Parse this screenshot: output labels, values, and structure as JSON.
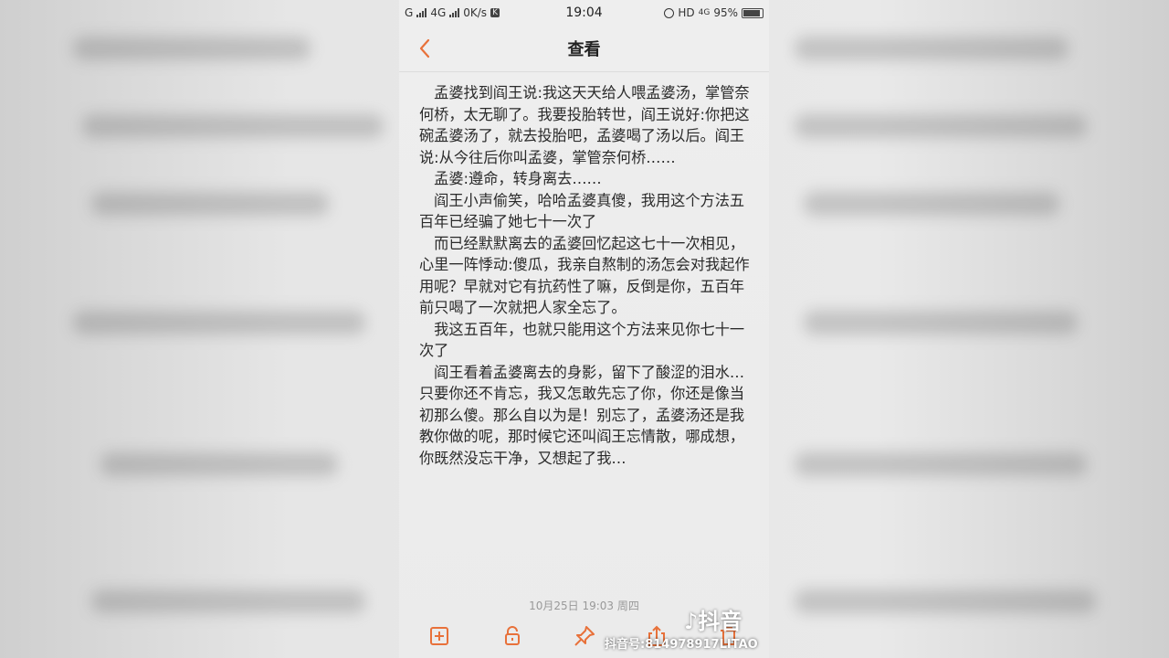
{
  "status_bar": {
    "network_left": "G",
    "network_mid": "4G",
    "speed": "0K/s",
    "app_badge": "K",
    "time": "19:04",
    "right_text": "HD",
    "network_right": "4G",
    "battery": "95%"
  },
  "nav": {
    "title": "查看"
  },
  "note": {
    "paragraphs": [
      "　孟婆找到阎王说:我这天天给人喂孟婆汤，掌管奈何桥，太无聊了。我要投胎转世，阎王说好:你把这碗孟婆汤了，就去投胎吧，孟婆喝了汤以后。阎王说:从今往后你叫孟婆，掌管奈何桥……",
      "　孟婆:遵命，转身离去……",
      "　阎王小声偷笑，哈哈孟婆真傻，我用这个方法五百年已经骗了她七十一次了",
      "　而已经默默离去的孟婆回忆起这七十一次相见，心里一阵悸动:傻瓜，我亲自熬制的汤怎会对我起作用呢？早就对它有抗药性了嘛，反倒是你，五百年前只喝了一次就把人家全忘了。",
      "　我这五百年，也就只能用这个方法来见你七十一次了",
      "　阎王看着孟婆离去的身影，留下了酸涩的泪水…",
      "只要你还不肯忘，我又怎敢先忘了你，你还是像当初那么傻。那么自以为是！别忘了，孟婆汤还是我教你做的呢，那时候它还叫阎王忘情散，哪成想，你既然没忘干净，又想起了我…"
    ],
    "timestamp": "10月25日 19:03 周四"
  },
  "toolbar": {
    "icons": [
      "add-note-icon",
      "lock-icon",
      "pin-icon",
      "share-icon",
      "delete-icon"
    ]
  },
  "watermark": {
    "logo": "抖音",
    "id": "抖音号:814978917LITAO"
  },
  "colors": {
    "accent": "#e8713a",
    "text": "#2a2a2a",
    "background": "#ececec"
  }
}
